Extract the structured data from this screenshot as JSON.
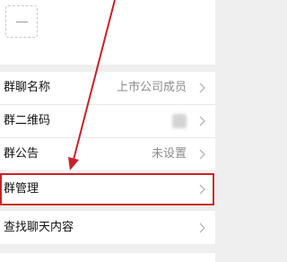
{
  "group_info": {
    "rows": [
      {
        "label": "群聊名称",
        "value": "上市公司成员"
      },
      {
        "label": "群二维码",
        "value": ""
      },
      {
        "label": "群公告",
        "value": "未设置"
      },
      {
        "label": "群管理",
        "value": ""
      }
    ]
  },
  "chat": {
    "search_label": "查找聊天内容"
  },
  "icons": {
    "member_slot": "minus-icon",
    "row_arrow": "chevron-right-icon",
    "qr": "qr-code-icon"
  },
  "colors": {
    "highlight": "#c9212a",
    "arrow": "#c9212a",
    "background": "#efefef",
    "value_text": "#8c8c8c"
  }
}
